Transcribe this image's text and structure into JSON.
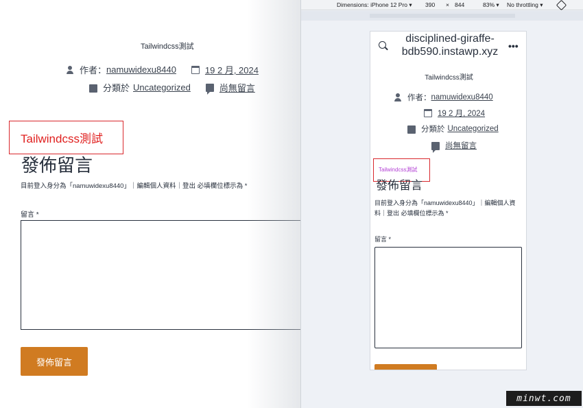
{
  "desktop": {
    "site_title": "Tailwindcss測試",
    "author_prefix": "作者：",
    "author_name": "namuwidexu8440",
    "date": "19 2 月, 2024",
    "category_prefix": "分類於",
    "category": "Uncategorized",
    "comments_link": "尚無留言",
    "annotation_label": "Tailwindcss測試",
    "heading": "發佈留言",
    "logged_in_text": "目前登入身分為「namuwidexu8440」｜編輯個人資料｜登出 必填欄位標示為 *",
    "comment_label": "留言 *",
    "submit_label": "發佈留言"
  },
  "devtools": {
    "dimensions_label": "Dimensions: iPhone 12 Pro ▾",
    "width": "390",
    "times": "×",
    "height": "844",
    "zoom": "83% ▾",
    "throttling": "No throttling ▾"
  },
  "mobile": {
    "domain": "disciplined-giraffe-bdb590.instawp.xyz",
    "more": "•••",
    "site_title": "Tailwindcss測試",
    "author_prefix": "作者：",
    "author_name": "namuwidexu8440",
    "date": "19 2 月, 2024",
    "category_prefix": "分類於",
    "category": "Uncategorized",
    "comments_link": "尚無留言",
    "annotation_label": "Tailwindcss測試",
    "heading": "發佈留言",
    "logged_in_text": "目前登入身分為「namuwidexu8440」｜編輯個人資料｜登出 必填欄位標示為 *",
    "comment_label": "留言 *"
  },
  "watermark": "minwt.com",
  "colors": {
    "accent_button": "#d07b21",
    "annotation_border": "#d9262b",
    "annotation_text_desktop": "#e0201f",
    "annotation_text_mobile": "#b23fd4",
    "text": "#28303d"
  }
}
